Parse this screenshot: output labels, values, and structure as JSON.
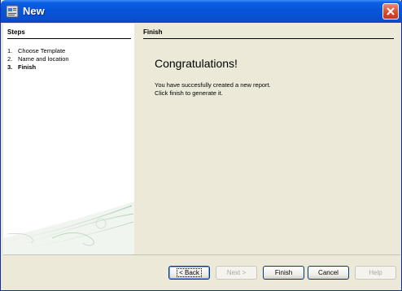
{
  "window": {
    "title": "New"
  },
  "sidebar": {
    "title": "Steps",
    "steps": [
      {
        "num": "1.",
        "label": "Choose Template"
      },
      {
        "num": "2.",
        "label": "Name and location"
      },
      {
        "num": "3.",
        "label": "Finish"
      }
    ]
  },
  "content": {
    "section_title": "Finish",
    "heading": "Congratulations!",
    "line1": "You have succesfully created a new report.",
    "line2": "Click finish to generate it."
  },
  "buttons": {
    "back": "< Back",
    "next": "Next >",
    "finish": "Finish",
    "cancel": "Cancel",
    "help": "Help"
  },
  "icons": {
    "app": "report-icon",
    "close": "close-icon"
  },
  "colors": {
    "titlebar": "#0654d8",
    "close": "#d9472a",
    "dialog_bg": "#ece9d8"
  }
}
